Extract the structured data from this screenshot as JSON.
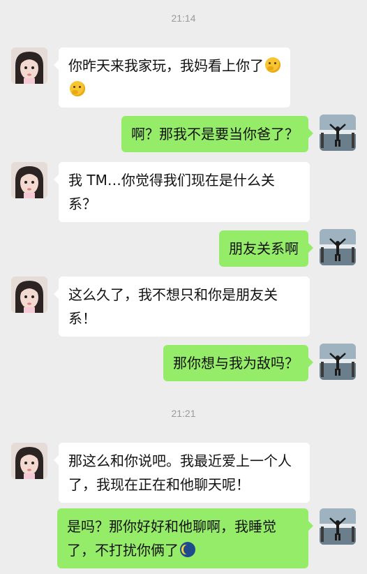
{
  "timestamps": [
    "21:14",
    "21:21"
  ],
  "messages": [
    {
      "side": "left",
      "text": "你昨天来我家玩，我妈看上你了",
      "emoji": "thinking-face"
    },
    {
      "side": "right",
      "text": "啊？那我不是要当你爸了？"
    },
    {
      "side": "left",
      "text": "我 TM…你觉得我们现在是什么关系？"
    },
    {
      "side": "right",
      "text": "朋友关系啊"
    },
    {
      "side": "left",
      "text": "这么久了，我不想只和你是朋友关系！"
    },
    {
      "side": "right",
      "text": "那你想与我为敌吗？"
    },
    {
      "side": "left",
      "text": "那这么和你说吧。我最近爱上一个人了，我现在正在和他聊天呢！"
    },
    {
      "side": "right",
      "text": "是吗？那你好好和他聊啊，我睡觉了，不打扰你俩了",
      "emoji": "sleeping-moon"
    }
  ],
  "colors": {
    "background": "#ededed",
    "bubble_left": "#ffffff",
    "bubble_right": "#95ec69"
  }
}
